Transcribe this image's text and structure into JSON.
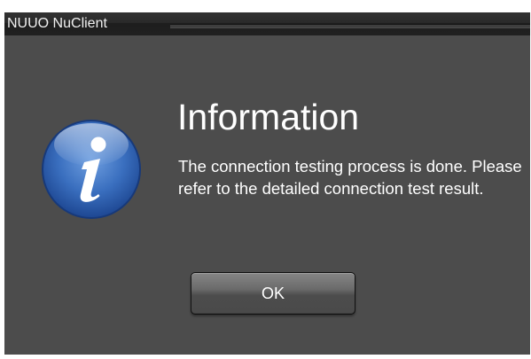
{
  "window": {
    "title": "NUUO NuClient"
  },
  "dialog": {
    "icon": "info-icon",
    "heading": "Information",
    "message": "The connection testing process is done. Please refer to the detailed connection test result.",
    "ok_label": "OK"
  },
  "colors": {
    "background": "#4c4c4c",
    "titlebar": "#262626",
    "icon_blue": "#2d5fa6",
    "text": "#ffffff"
  }
}
